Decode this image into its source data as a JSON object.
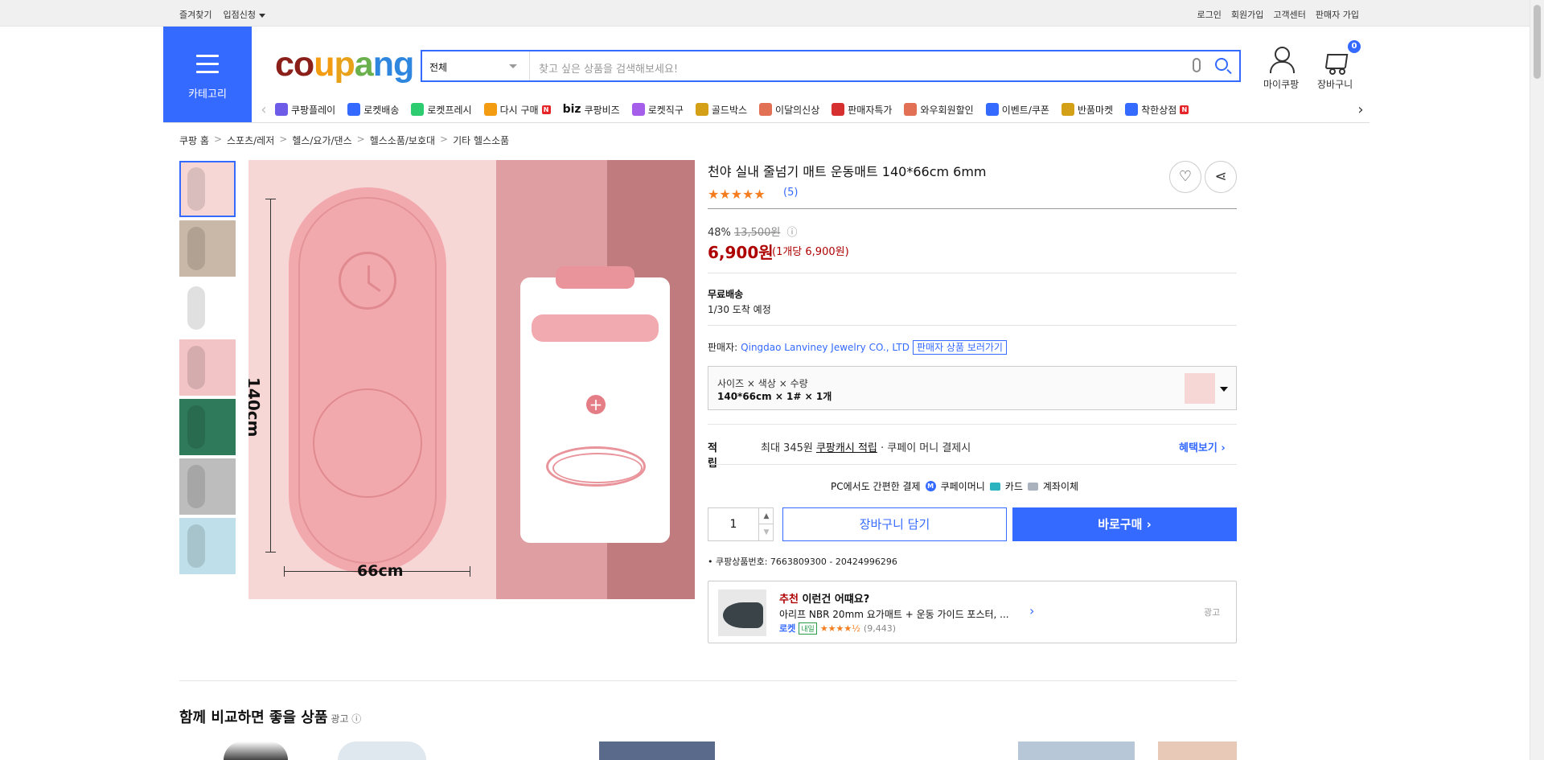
{
  "topbar": {
    "bookmark": "즐겨찾기",
    "apply": "입점신청",
    "login": "로그인",
    "signup": "회원가입",
    "support": "고객센터",
    "seller_signup": "판매자 가입"
  },
  "header": {
    "category_label": "카테고리",
    "logo_letters": [
      "c",
      "o",
      "u",
      "p",
      "a",
      "n",
      "g"
    ],
    "logo_colors": [
      "#8b1f1a",
      "#8b1f1a",
      "#f39c12",
      "#e8a21a",
      "#6ab04c",
      "#2e86de",
      "#2e86de"
    ],
    "search_scope": "전체",
    "search_placeholder": "찾고 싶은 상품을 검색해보세요!",
    "mypage": "마이쿠팡",
    "cart": "장바구니",
    "cart_count": "0"
  },
  "nav": [
    {
      "label": "쿠팡플레이",
      "color": "#6c5ce7"
    },
    {
      "label": "로켓배송",
      "color": "#346aff"
    },
    {
      "label": "로켓프레시",
      "color": "#2ecc71"
    },
    {
      "label": "다시 구매",
      "color": "#f39c12",
      "badge": "N"
    },
    {
      "label": "쿠팡비즈",
      "prefix": "biz",
      "color": "#111"
    },
    {
      "label": "로켓직구",
      "color": "#a55eea"
    },
    {
      "label": "골드박스",
      "color": "#d4a017"
    },
    {
      "label": "이달의신상",
      "color": "#e17055"
    },
    {
      "label": "판매자특가",
      "color": "#d63031"
    },
    {
      "label": "와우회원할인",
      "color": "#e17055"
    },
    {
      "label": "이벤트/쿠폰",
      "color": "#346aff"
    },
    {
      "label": "반품마켓",
      "color": "#d4a017"
    },
    {
      "label": "착한상점",
      "color": "#346aff",
      "badge": "N"
    }
  ],
  "breadcrumb": [
    "쿠팡 홈",
    "스포츠/레저",
    "헬스/요가/댄스",
    "헬스소품/보호대",
    "기타 헬스소품"
  ],
  "product": {
    "title": "천야 실내 줄넘기 매트 운동매트 140*66cm 6mm",
    "stars": "★★★★★",
    "rating_count": "(5)",
    "discount": "48%",
    "original_price": "13,500원",
    "info_icon": "ⓘ",
    "price": "6,900원",
    "unit_price": "(1개당 6,900원)",
    "shipping_title": "무료배송",
    "arrival": "1/30 도착 예정",
    "seller_label": "판매자:",
    "seller_name": "Qingdao Lanviney Jewelry CO., LTD",
    "seller_btn": "판매자 상품 보러가기",
    "option_label": "사이즈 × 색상 × 수량",
    "option_value": "140*66cm × 1# × 1개",
    "image_text": {
      "h": "140cm",
      "w": "66cm",
      "plus": "+"
    }
  },
  "reward": {
    "label": "적립",
    "text_pre": "최대 345원 ",
    "text_link": "쿠팡캐시 적립",
    "text_post": " · 쿠페이 머니 결제시",
    "benefit": "혜택보기 ›"
  },
  "payment": {
    "title": "PC에서도 간편한 결제",
    "m1": "쿠페이머니",
    "m1_icon": "M",
    "m2": "카드",
    "m3": "계좌이체"
  },
  "purchase": {
    "qty": "1",
    "add_cart": "장바구니 담기",
    "buy_now": "바로구매 ›"
  },
  "product_no": "쿠팡상품번호: 7663809300 - 20424996296",
  "recommend": {
    "highlight": "추천",
    "title": " 이런건 어떄요?",
    "item": "아리프 NBR 20mm 요가매트 + 운동 가이드 포스터, ...",
    "rocket": "로켓",
    "tomorrow": "내일",
    "stars": "★★★★½",
    "count": "(9,443)",
    "ad": "광고"
  },
  "compare": {
    "title": "함께 비교하면 좋을 상품",
    "ad": "광고 ⓘ"
  },
  "thumbs": [
    "#f7d6d6",
    "#c9b8a8",
    "#ffffff",
    "#f2c4c6",
    "#2f7a5a",
    "#bdbdbd",
    "#bfe0ea"
  ]
}
